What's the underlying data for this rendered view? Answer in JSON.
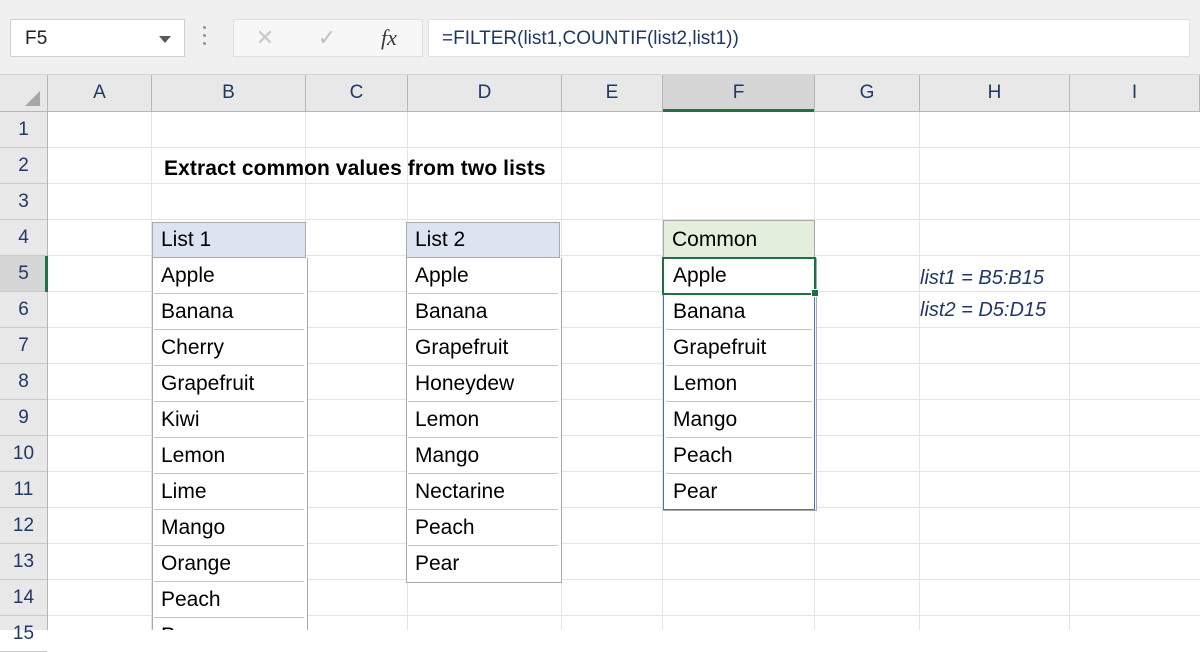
{
  "formula_bar": {
    "name_box_value": "F5",
    "name_box_dropdown_icon": "chevron-down-icon",
    "more_options_icon": "vertical-dots-icon",
    "cancel_icon": "cancel-x-icon",
    "enter_icon": "enter-check-icon",
    "insert_function_icon": "fx-icon",
    "insert_function_label": "fx",
    "cancel_label": "✕",
    "enter_label": "✓",
    "formula": "=FILTER(list1,COUNTIF(list2,list1))"
  },
  "grid": {
    "select_all_icon": "select-all-corner-icon",
    "columns": [
      "A",
      "B",
      "C",
      "D",
      "E",
      "F",
      "G",
      "H",
      "I"
    ],
    "selected_column": "F",
    "rows": [
      "1",
      "2",
      "3",
      "4",
      "5",
      "6",
      "7",
      "8",
      "9",
      "10",
      "11",
      "12",
      "13",
      "14",
      "15"
    ],
    "selected_row": "5"
  },
  "sheet": {
    "title": "Extract common values from two lists",
    "list1": {
      "header": "List 1",
      "items": [
        "Apple",
        "Banana",
        "Cherry",
        "Grapefruit",
        "Kiwi",
        "Lemon",
        "Lime",
        "Mango",
        "Orange",
        "Peach",
        "Pear"
      ]
    },
    "list2": {
      "header": "List 2",
      "items": [
        "Apple",
        "Banana",
        "Grapefruit",
        "Honeydew",
        "Lemon",
        "Mango",
        "Nectarine",
        "Peach",
        "Pear"
      ]
    },
    "common": {
      "header": "Common",
      "items": [
        "Apple",
        "Banana",
        "Grapefruit",
        "Lemon",
        "Mango",
        "Peach",
        "Pear"
      ]
    },
    "notes": [
      "list1 = B5:B15",
      "list2 = D5:D15"
    ]
  },
  "colors": {
    "excel_green": "#217346",
    "selection_green": "#1e7145",
    "spill_blue": "#4472c4",
    "header_blue_fill": "#dce3f1",
    "header_green_fill": "#e3efdc",
    "text_blue": "#1f3864"
  }
}
